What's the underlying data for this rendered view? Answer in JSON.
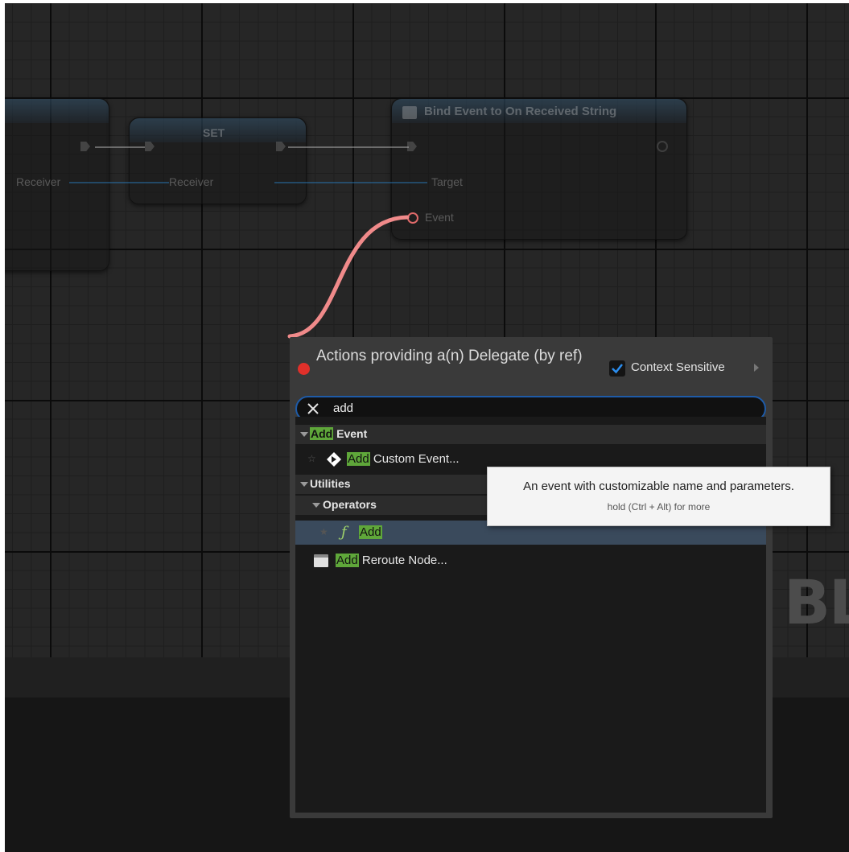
{
  "graph": {
    "watermark": "BL",
    "nodes": {
      "receiver_left": {
        "pin_label": "Receiver"
      },
      "set_node": {
        "title": "SET",
        "pin_label": "Receiver"
      },
      "bind_node": {
        "title": "Bind Event to On Received String",
        "target_label": "Target",
        "event_label": "Event"
      }
    },
    "colors": {
      "delegate_wire": "#f08080",
      "exec_wire": "#b4b4b4",
      "object_wire": "#2a7fc2"
    }
  },
  "menu": {
    "title": "Actions providing a(n) Delegate (by ref)",
    "context_sensitive": {
      "label": "Context Sensitive",
      "checked": true
    },
    "search": {
      "value": "add",
      "clear_icon": "close-icon"
    },
    "rows": [
      {
        "type": "category",
        "highlight": "Add",
        "rest": " Event",
        "icon": "chevron-down-icon"
      },
      {
        "type": "item",
        "highlight": "Add",
        "rest": " Custom Event...",
        "icon": "custom-event-icon",
        "star": "star-icon"
      },
      {
        "type": "category",
        "label": "Utilities",
        "icon": "chevron-down-icon"
      },
      {
        "type": "subcategory",
        "label": "Operators",
        "icon": "chevron-down-icon"
      },
      {
        "type": "item",
        "highlight": "Add",
        "rest": "",
        "icon": "function-icon",
        "glyph": "ƒ",
        "star": "star-icon",
        "selected": true
      },
      {
        "type": "item",
        "highlight": "Add",
        "rest": " Reroute Node...",
        "icon": "reroute-node-icon"
      }
    ]
  },
  "tooltip": {
    "text": "An event with customizable name and parameters.",
    "hint": "hold (Ctrl + Alt) for more"
  }
}
